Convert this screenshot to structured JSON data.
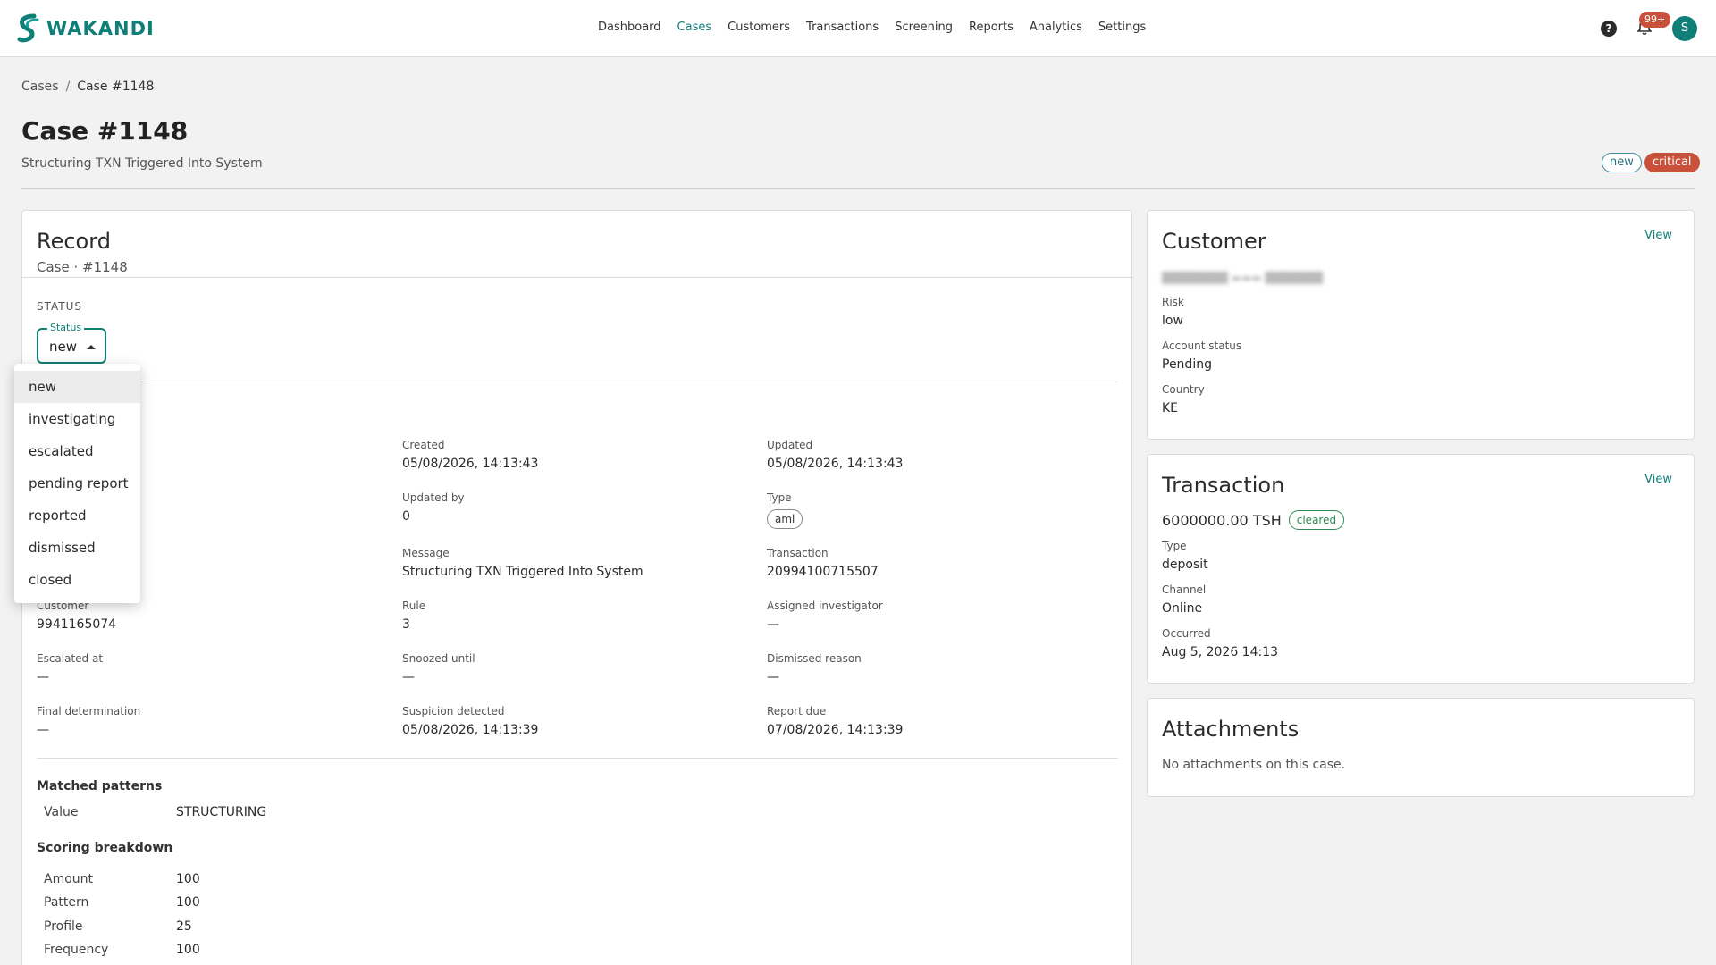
{
  "app": {
    "brand": "WAKANDI",
    "brand_color": "#0f7f78"
  },
  "nav": {
    "items": [
      "Dashboard",
      "Cases",
      "Customers",
      "Transactions",
      "Screening",
      "Reports",
      "Analytics",
      "Settings"
    ],
    "active": "Cases",
    "help_icon": "question-circle-icon",
    "bell_icon": "bell-icon",
    "notifications_badge": "99+",
    "avatar_initial": "S"
  },
  "breadcrumb": {
    "parent": "Cases",
    "separator": "/",
    "current": "Case #1148"
  },
  "page": {
    "title": "Case #1148",
    "subtitle": "Structuring TXN Triggered Into System",
    "badges": {
      "status": "new",
      "severity": "critical"
    }
  },
  "record": {
    "title": "Record",
    "subtitle": "Case · #1148",
    "status_section": "STATUS",
    "status_select": {
      "legend": "Status",
      "value": "new"
    },
    "status_options": [
      "new",
      "investigating",
      "escalated",
      "pending report",
      "reported",
      "dismissed",
      "closed"
    ],
    "fields": {
      "created": {
        "label": "Created",
        "value": "05/08/2026, 14:13:43"
      },
      "updated": {
        "label": "Updated",
        "value": "05/08/2026, 14:13:43"
      },
      "updated_by": {
        "label": "Updated by",
        "value": "0"
      },
      "type": {
        "label": "Type",
        "value": "aml"
      },
      "message": {
        "label": "Message",
        "value": "Structuring TXN Triggered Into System"
      },
      "transaction": {
        "label": "Transaction",
        "value": "20994100715507"
      },
      "customer": {
        "label": "Customer",
        "value": "9941165074"
      },
      "rule": {
        "label": "Rule",
        "value": "3"
      },
      "assigned_investigator": {
        "label": "Assigned investigator",
        "value": "—"
      },
      "escalated_at": {
        "label": "Escalated at",
        "value": "—"
      },
      "snoozed_until": {
        "label": "Snoozed until",
        "value": "—"
      },
      "dismissed_reason": {
        "label": "Dismissed reason",
        "value": "—"
      },
      "final_determination": {
        "label": "Final determination",
        "value": "—"
      },
      "suspicion_detected": {
        "label": "Suspicion detected",
        "value": "05/08/2026, 14:13:39"
      },
      "report_due": {
        "label": "Report due",
        "value": "07/08/2026, 14:13:39"
      }
    },
    "matched_patterns": {
      "heading": "Matched patterns",
      "key": "Value",
      "value": "STRUCTURING"
    },
    "scoring": {
      "heading": "Scoring breakdown",
      "rows": [
        {
          "key": "Amount",
          "value": "100"
        },
        {
          "key": "Pattern",
          "value": "100"
        },
        {
          "key": "Profile",
          "value": "25"
        },
        {
          "key": "Frequency",
          "value": "100"
        }
      ]
    }
  },
  "customer": {
    "title": "Customer",
    "view": "View",
    "risk": {
      "label": "Risk",
      "value": "low"
    },
    "account_status": {
      "label": "Account status",
      "value": "Pending"
    },
    "country": {
      "label": "Country",
      "value": "KE"
    }
  },
  "transaction": {
    "title": "Transaction",
    "view": "View",
    "amount": "6000000.00 TSH",
    "status": "cleared",
    "type": {
      "label": "Type",
      "value": "deposit"
    },
    "channel": {
      "label": "Channel",
      "value": "Online"
    },
    "occurred": {
      "label": "Occurred",
      "value": "Aug 5, 2026 14:13"
    }
  },
  "attachments": {
    "title": "Attachments",
    "empty": "No attachments on this case."
  }
}
